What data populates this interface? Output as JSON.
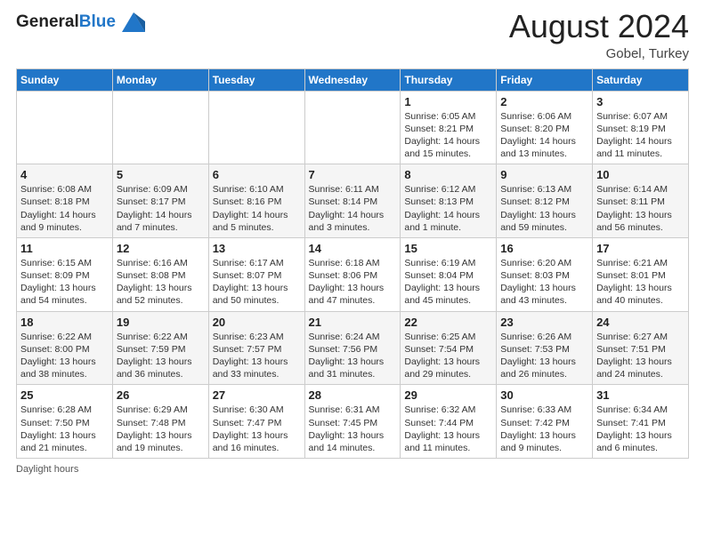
{
  "header": {
    "logo_line1": "General",
    "logo_line2": "Blue",
    "month_year": "August 2024",
    "location": "Gobel, Turkey"
  },
  "days_of_week": [
    "Sunday",
    "Monday",
    "Tuesday",
    "Wednesday",
    "Thursday",
    "Friday",
    "Saturday"
  ],
  "weeks": [
    [
      {
        "day": "",
        "info": ""
      },
      {
        "day": "",
        "info": ""
      },
      {
        "day": "",
        "info": ""
      },
      {
        "day": "",
        "info": ""
      },
      {
        "day": "1",
        "info": "Sunrise: 6:05 AM\nSunset: 8:21 PM\nDaylight: 14 hours\nand 15 minutes."
      },
      {
        "day": "2",
        "info": "Sunrise: 6:06 AM\nSunset: 8:20 PM\nDaylight: 14 hours\nand 13 minutes."
      },
      {
        "day": "3",
        "info": "Sunrise: 6:07 AM\nSunset: 8:19 PM\nDaylight: 14 hours\nand 11 minutes."
      }
    ],
    [
      {
        "day": "4",
        "info": "Sunrise: 6:08 AM\nSunset: 8:18 PM\nDaylight: 14 hours\nand 9 minutes."
      },
      {
        "day": "5",
        "info": "Sunrise: 6:09 AM\nSunset: 8:17 PM\nDaylight: 14 hours\nand 7 minutes."
      },
      {
        "day": "6",
        "info": "Sunrise: 6:10 AM\nSunset: 8:16 PM\nDaylight: 14 hours\nand 5 minutes."
      },
      {
        "day": "7",
        "info": "Sunrise: 6:11 AM\nSunset: 8:14 PM\nDaylight: 14 hours\nand 3 minutes."
      },
      {
        "day": "8",
        "info": "Sunrise: 6:12 AM\nSunset: 8:13 PM\nDaylight: 14 hours\nand 1 minute."
      },
      {
        "day": "9",
        "info": "Sunrise: 6:13 AM\nSunset: 8:12 PM\nDaylight: 13 hours\nand 59 minutes."
      },
      {
        "day": "10",
        "info": "Sunrise: 6:14 AM\nSunset: 8:11 PM\nDaylight: 13 hours\nand 56 minutes."
      }
    ],
    [
      {
        "day": "11",
        "info": "Sunrise: 6:15 AM\nSunset: 8:09 PM\nDaylight: 13 hours\nand 54 minutes."
      },
      {
        "day": "12",
        "info": "Sunrise: 6:16 AM\nSunset: 8:08 PM\nDaylight: 13 hours\nand 52 minutes."
      },
      {
        "day": "13",
        "info": "Sunrise: 6:17 AM\nSunset: 8:07 PM\nDaylight: 13 hours\nand 50 minutes."
      },
      {
        "day": "14",
        "info": "Sunrise: 6:18 AM\nSunset: 8:06 PM\nDaylight: 13 hours\nand 47 minutes."
      },
      {
        "day": "15",
        "info": "Sunrise: 6:19 AM\nSunset: 8:04 PM\nDaylight: 13 hours\nand 45 minutes."
      },
      {
        "day": "16",
        "info": "Sunrise: 6:20 AM\nSunset: 8:03 PM\nDaylight: 13 hours\nand 43 minutes."
      },
      {
        "day": "17",
        "info": "Sunrise: 6:21 AM\nSunset: 8:01 PM\nDaylight: 13 hours\nand 40 minutes."
      }
    ],
    [
      {
        "day": "18",
        "info": "Sunrise: 6:22 AM\nSunset: 8:00 PM\nDaylight: 13 hours\nand 38 minutes."
      },
      {
        "day": "19",
        "info": "Sunrise: 6:22 AM\nSunset: 7:59 PM\nDaylight: 13 hours\nand 36 minutes."
      },
      {
        "day": "20",
        "info": "Sunrise: 6:23 AM\nSunset: 7:57 PM\nDaylight: 13 hours\nand 33 minutes."
      },
      {
        "day": "21",
        "info": "Sunrise: 6:24 AM\nSunset: 7:56 PM\nDaylight: 13 hours\nand 31 minutes."
      },
      {
        "day": "22",
        "info": "Sunrise: 6:25 AM\nSunset: 7:54 PM\nDaylight: 13 hours\nand 29 minutes."
      },
      {
        "day": "23",
        "info": "Sunrise: 6:26 AM\nSunset: 7:53 PM\nDaylight: 13 hours\nand 26 minutes."
      },
      {
        "day": "24",
        "info": "Sunrise: 6:27 AM\nSunset: 7:51 PM\nDaylight: 13 hours\nand 24 minutes."
      }
    ],
    [
      {
        "day": "25",
        "info": "Sunrise: 6:28 AM\nSunset: 7:50 PM\nDaylight: 13 hours\nand 21 minutes."
      },
      {
        "day": "26",
        "info": "Sunrise: 6:29 AM\nSunset: 7:48 PM\nDaylight: 13 hours\nand 19 minutes."
      },
      {
        "day": "27",
        "info": "Sunrise: 6:30 AM\nSunset: 7:47 PM\nDaylight: 13 hours\nand 16 minutes."
      },
      {
        "day": "28",
        "info": "Sunrise: 6:31 AM\nSunset: 7:45 PM\nDaylight: 13 hours\nand 14 minutes."
      },
      {
        "day": "29",
        "info": "Sunrise: 6:32 AM\nSunset: 7:44 PM\nDaylight: 13 hours\nand 11 minutes."
      },
      {
        "day": "30",
        "info": "Sunrise: 6:33 AM\nSunset: 7:42 PM\nDaylight: 13 hours\nand 9 minutes."
      },
      {
        "day": "31",
        "info": "Sunrise: 6:34 AM\nSunset: 7:41 PM\nDaylight: 13 hours\nand 6 minutes."
      }
    ]
  ],
  "footer": {
    "label": "Daylight hours"
  }
}
